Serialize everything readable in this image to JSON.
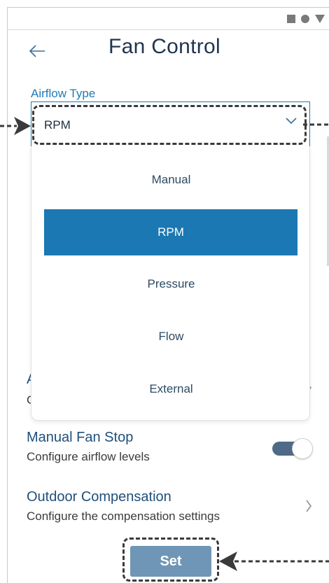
{
  "screen": {
    "title": "Fan Control"
  },
  "icons": {
    "back": "arrow-left-icon",
    "status": [
      "square-icon",
      "circle-icon",
      "triangle-icon"
    ],
    "dropdown_chevron": "chevron-down-icon",
    "row_chevron": "chevron-right-icon"
  },
  "airflow": {
    "label": "Airflow Type",
    "value": "RPM",
    "options": [
      "Manual",
      "RPM",
      "Pressure",
      "Flow",
      "External"
    ],
    "selected_index": 1
  },
  "hidden_row": {
    "title_fragment": "A",
    "subtitle_fragment": "C"
  },
  "rows": [
    {
      "title": "Manual Fan Stop",
      "subtitle": "Configure airflow levels",
      "toggle_on": true
    },
    {
      "title": "Outdoor Compensation",
      "subtitle": "Configure the compensation settings"
    }
  ],
  "actions": {
    "set_label": "Set"
  },
  "colors": {
    "accent": "#1b78b2",
    "title": "#1f3550",
    "button": "#6f96b6",
    "toggle": "#4f6a86"
  }
}
